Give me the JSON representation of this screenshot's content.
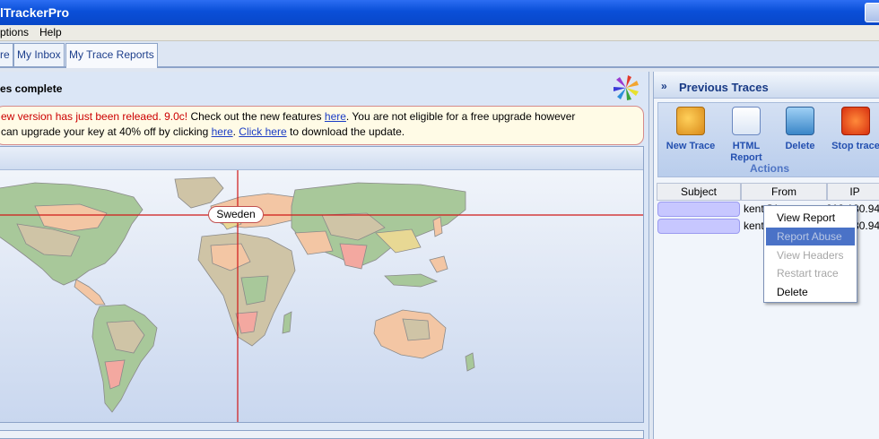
{
  "window": {
    "title": "lTrackerPro"
  },
  "menu": [
    "ptions",
    "Help"
  ],
  "tabs": [
    {
      "label": "re",
      "active": false
    },
    {
      "label": "My Inbox",
      "active": false
    },
    {
      "label": "My Trace Reports",
      "active": true
    }
  ],
  "status": {
    "title": "es complete"
  },
  "notice": {
    "line1_red": "ew version has just been releaed. 9.0c!",
    "line1_text": " Check out the new features ",
    "line1_link": "here",
    "line1_tail": ". You are not eligible for a free upgrade however",
    "line2_text": " can upgrade your key at 40% off by clicking ",
    "line2_link": "here",
    "line2_sep": ". ",
    "line2_link2": "Click here",
    "line2_tail": " to download the update."
  },
  "map": {
    "marker_label": "Sweden"
  },
  "sidebar": {
    "title": "Previous Traces",
    "chevron": "»",
    "actions": [
      {
        "label": "New Trace",
        "icon": "new-trace-icon"
      },
      {
        "label": "HTML Report",
        "icon": "html-report-icon"
      },
      {
        "label": "Delete",
        "icon": "delete-icon"
      },
      {
        "label": "Stop trace",
        "icon": "stop-trace-icon"
      }
    ],
    "actions_label": "Actions",
    "columns": [
      "Subject",
      "From",
      "IP"
    ],
    "rows": [
      {
        "subject": "",
        "from": "kent@j...",
        "ip": "213.180.94"
      },
      {
        "subject": "",
        "from": "kent",
        "ip": "213.180.94"
      }
    ]
  },
  "context_menu": {
    "items": [
      {
        "label": "View Report",
        "state": "normal"
      },
      {
        "label": "Report Abuse",
        "state": "highlighted"
      },
      {
        "label": "View Headers",
        "state": "disabled"
      },
      {
        "label": "Restart trace",
        "state": "disabled"
      },
      {
        "label": "Delete",
        "state": "normal"
      }
    ]
  },
  "colors": {
    "title_bar": "#0a4fd8",
    "link": "#1a3cc5",
    "notice_red": "#cc0000",
    "highlight": "#4a72c7"
  }
}
